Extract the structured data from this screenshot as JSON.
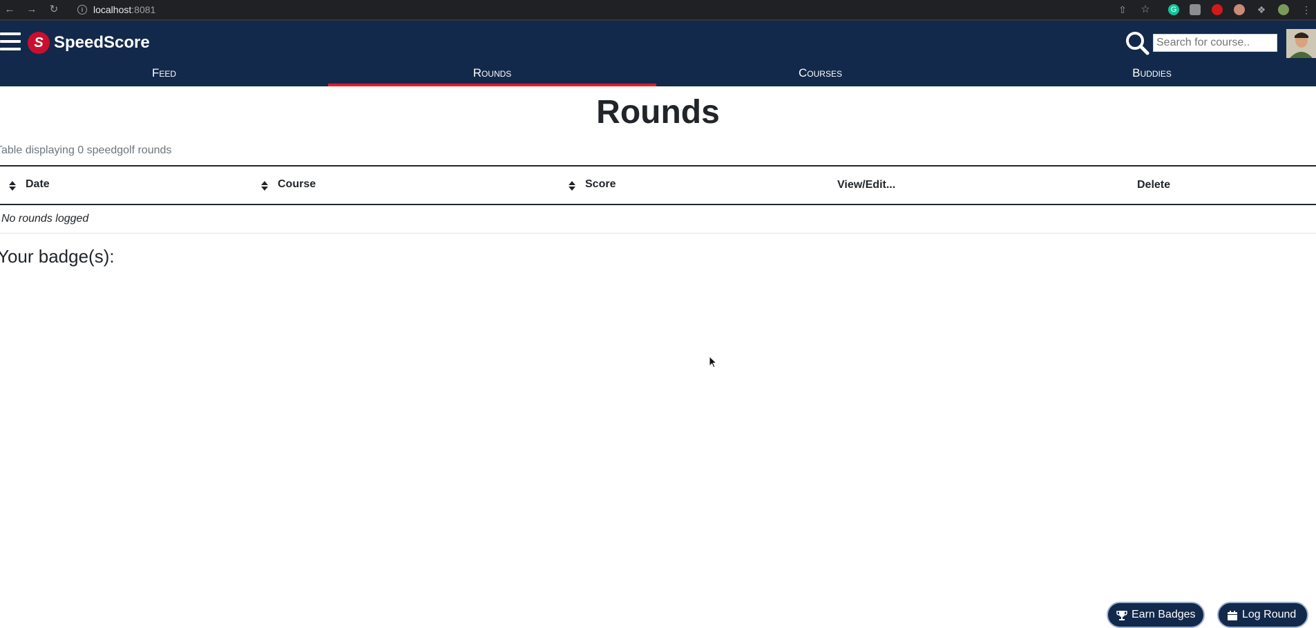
{
  "browser": {
    "url_host": "localhost",
    "url_port": ":8081"
  },
  "app": {
    "brand": "SpeedScore",
    "search_placeholder": "Search for course..",
    "tabs": [
      {
        "label": "Feed",
        "active": false
      },
      {
        "label": "Rounds",
        "active": true
      },
      {
        "label": "Courses",
        "active": false
      },
      {
        "label": "Buddies",
        "active": false
      }
    ],
    "colors": {
      "header": "#13294b",
      "active_tab": "#e11d2a"
    }
  },
  "main": {
    "title": "Rounds",
    "caption": "Table displaying 0 speedgolf rounds",
    "columns": [
      "Date",
      "Course",
      "Score",
      "View/Edit...",
      "Delete"
    ],
    "empty_message": "No rounds logged",
    "badges_heading": "Your badge(s):"
  },
  "actions": {
    "earn_badges": "Earn Badges",
    "log_round": "Log Round"
  }
}
